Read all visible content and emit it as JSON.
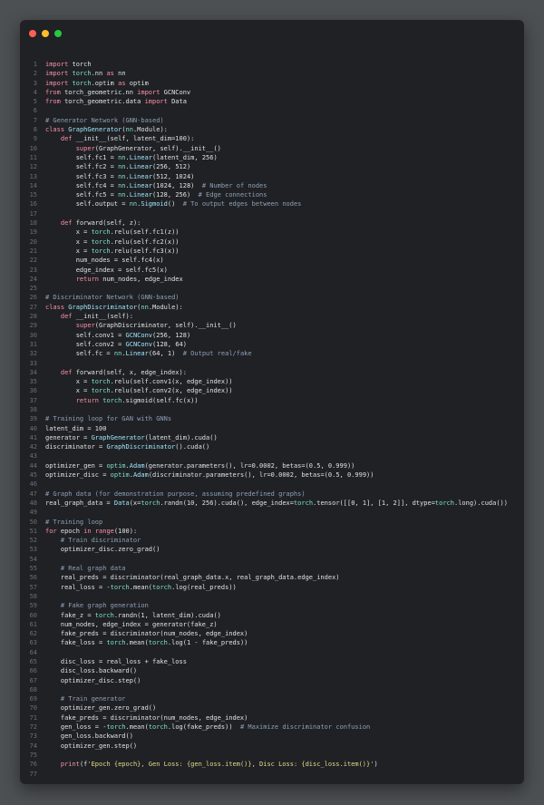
{
  "window": {
    "controls": [
      "close",
      "minimize",
      "maximize"
    ],
    "colors": {
      "close": "#fe5f57",
      "minimize": "#febc2e",
      "maximize": "#28c840",
      "background": "#1f2124"
    }
  },
  "code_lines": [
    {
      "n": "1",
      "text": "import torch"
    },
    {
      "n": "2",
      "text": "import torch.nn as nn"
    },
    {
      "n": "3",
      "text": "import torch.optim as optim"
    },
    {
      "n": "4",
      "text": "from torch_geometric.nn import GCNConv"
    },
    {
      "n": "5",
      "text": "from torch_geometric.data import Data"
    },
    {
      "n": "6",
      "text": ""
    },
    {
      "n": "7",
      "text": "# Generator Network (GNN-based)"
    },
    {
      "n": "8",
      "text": "class GraphGenerator(nn.Module):"
    },
    {
      "n": "9",
      "text": "    def __init__(self, latent_dim=100):"
    },
    {
      "n": "10",
      "text": "        super(GraphGenerator, self).__init__()"
    },
    {
      "n": "11",
      "text": "        self.fc1 = nn.Linear(latent_dim, 256)"
    },
    {
      "n": "12",
      "text": "        self.fc2 = nn.Linear(256, 512)"
    },
    {
      "n": "13",
      "text": "        self.fc3 = nn.Linear(512, 1024)"
    },
    {
      "n": "14",
      "text": "        self.fc4 = nn.Linear(1024, 128)  # Number of nodes"
    },
    {
      "n": "15",
      "text": "        self.fc5 = nn.Linear(128, 256)  # Edge connections"
    },
    {
      "n": "16",
      "text": "        self.output = nn.Sigmoid()  # To output edges between nodes"
    },
    {
      "n": "17",
      "text": ""
    },
    {
      "n": "18",
      "text": "    def forward(self, z):"
    },
    {
      "n": "19",
      "text": "        x = torch.relu(self.fc1(z))"
    },
    {
      "n": "20",
      "text": "        x = torch.relu(self.fc2(x))"
    },
    {
      "n": "21",
      "text": "        x = torch.relu(self.fc3(x))"
    },
    {
      "n": "22",
      "text": "        num_nodes = self.fc4(x)"
    },
    {
      "n": "23",
      "text": "        edge_index = self.fc5(x)"
    },
    {
      "n": "24",
      "text": "        return num_nodes, edge_index"
    },
    {
      "n": "25",
      "text": ""
    },
    {
      "n": "26",
      "text": "# Discriminator Network (GNN-based)"
    },
    {
      "n": "27",
      "text": "class GraphDiscriminator(nn.Module):"
    },
    {
      "n": "28",
      "text": "    def __init__(self):"
    },
    {
      "n": "29",
      "text": "        super(GraphDiscriminator, self).__init__()"
    },
    {
      "n": "30",
      "text": "        self.conv1 = GCNConv(256, 128)"
    },
    {
      "n": "31",
      "text": "        self.conv2 = GCNConv(128, 64)"
    },
    {
      "n": "32",
      "text": "        self.fc = nn.Linear(64, 1)  # Output real/fake"
    },
    {
      "n": "33",
      "text": ""
    },
    {
      "n": "34",
      "text": "    def forward(self, x, edge_index):"
    },
    {
      "n": "35",
      "text": "        x = torch.relu(self.conv1(x, edge_index))"
    },
    {
      "n": "36",
      "text": "        x = torch.relu(self.conv2(x, edge_index))"
    },
    {
      "n": "37",
      "text": "        return torch.sigmoid(self.fc(x))"
    },
    {
      "n": "38",
      "text": ""
    },
    {
      "n": "39",
      "text": "# Training loop for GAN with GNNs"
    },
    {
      "n": "40",
      "text": "latent_dim = 100"
    },
    {
      "n": "41",
      "text": "generator = GraphGenerator(latent_dim).cuda()"
    },
    {
      "n": "42",
      "text": "discriminator = GraphDiscriminator().cuda()"
    },
    {
      "n": "43",
      "text": ""
    },
    {
      "n": "44",
      "text": "optimizer_gen = optim.Adam(generator.parameters(), lr=0.0002, betas=(0.5, 0.999))"
    },
    {
      "n": "45",
      "text": "optimizer_disc = optim.Adam(discriminator.parameters(), lr=0.0002, betas=(0.5, 0.999))"
    },
    {
      "n": "46",
      "text": ""
    },
    {
      "n": "47",
      "text": "# Graph data (for demonstration purpose, assuming predefined graphs)"
    },
    {
      "n": "48",
      "text": "real_graph_data = Data(x=torch.randn(10, 256).cuda(), edge_index=torch.tensor([[0, 1], [1, 2]], dtype=torch.long).cuda())"
    },
    {
      "n": "49",
      "text": ""
    },
    {
      "n": "50",
      "text": "# Training loop"
    },
    {
      "n": "51",
      "text": "for epoch in range(100):"
    },
    {
      "n": "52",
      "text": "    # Train discriminator"
    },
    {
      "n": "53",
      "text": "    optimizer_disc.zero_grad()"
    },
    {
      "n": "54",
      "text": ""
    },
    {
      "n": "55",
      "text": "    # Real graph data"
    },
    {
      "n": "56",
      "text": "    real_preds = discriminator(real_graph_data.x, real_graph_data.edge_index)"
    },
    {
      "n": "57",
      "text": "    real_loss = -torch.mean(torch.log(real_preds))"
    },
    {
      "n": "58",
      "text": ""
    },
    {
      "n": "59",
      "text": "    # Fake graph generation"
    },
    {
      "n": "60",
      "text": "    fake_z = torch.randn(1, latent_dim).cuda()"
    },
    {
      "n": "61",
      "text": "    num_nodes, edge_index = generator(fake_z)"
    },
    {
      "n": "62",
      "text": "    fake_preds = discriminator(num_nodes, edge_index)"
    },
    {
      "n": "63",
      "text": "    fake_loss = torch.mean(torch.log(1 - fake_preds))"
    },
    {
      "n": "64",
      "text": ""
    },
    {
      "n": "65",
      "text": "    disc_loss = real_loss + fake_loss"
    },
    {
      "n": "66",
      "text": "    disc_loss.backward()"
    },
    {
      "n": "67",
      "text": "    optimizer_disc.step()"
    },
    {
      "n": "68",
      "text": ""
    },
    {
      "n": "69",
      "text": "    # Train generator"
    },
    {
      "n": "70",
      "text": "    optimizer_gen.zero_grad()"
    },
    {
      "n": "71",
      "text": "    fake_preds = discriminator(num_nodes, edge_index)"
    },
    {
      "n": "72",
      "text": "    gen_loss = -torch.mean(torch.log(fake_preds))  # Maximize discriminator confusion"
    },
    {
      "n": "73",
      "text": "    gen_loss.backward()"
    },
    {
      "n": "74",
      "text": "    optimizer_gen.step()"
    },
    {
      "n": "75",
      "text": ""
    },
    {
      "n": "76",
      "text": "    print(f'Epoch {epoch}, Gen Loss: {gen_loss.item()}, Disc Loss: {disc_loss.item()}')"
    },
    {
      "n": "77",
      "text": ""
    }
  ]
}
